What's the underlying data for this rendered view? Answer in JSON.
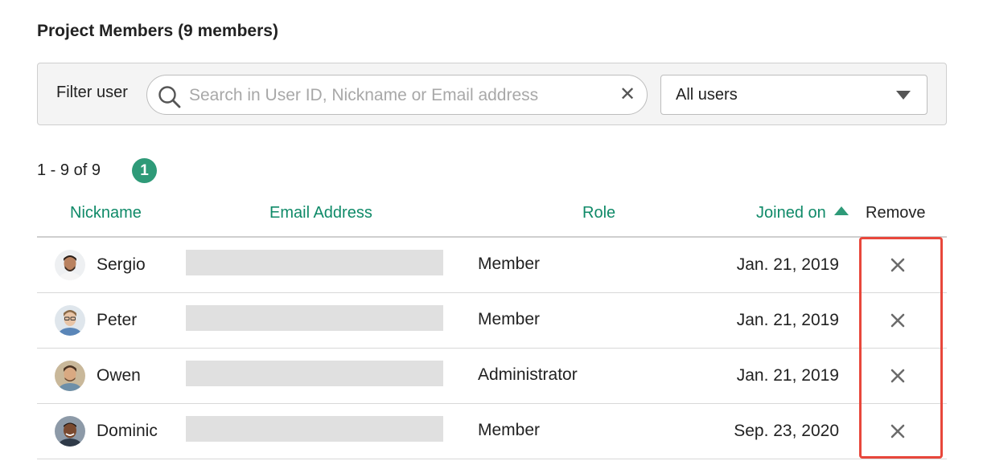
{
  "page": {
    "title": "Project Members (9 members)"
  },
  "filter": {
    "label": "Filter user",
    "search_placeholder": "Search in User ID, Nickname or Email address",
    "search_value": "",
    "role_select": "All users"
  },
  "pagination": {
    "range": "1 - 9 of 9",
    "current_page": "1"
  },
  "columns": {
    "nickname": "Nickname",
    "email": "Email Address",
    "role": "Role",
    "joined": "Joined on",
    "remove": "Remove"
  },
  "members": [
    {
      "nickname": "Sergio",
      "role": "Member",
      "joined": "Jan. 21, 2019",
      "avatar_icon": "user-avatar"
    },
    {
      "nickname": "Peter",
      "role": "Member",
      "joined": "Jan. 21, 2019",
      "avatar_icon": "user-avatar"
    },
    {
      "nickname": "Owen",
      "role": "Administrator",
      "joined": "Jan. 21, 2019",
      "avatar_icon": "user-avatar"
    },
    {
      "nickname": "Dominic",
      "role": "Member",
      "joined": "Sep. 23, 2020",
      "avatar_icon": "user-avatar"
    }
  ],
  "colors": {
    "accent": "#0f8a68",
    "badge": "#2e9a78",
    "highlight": "#e8473b"
  }
}
